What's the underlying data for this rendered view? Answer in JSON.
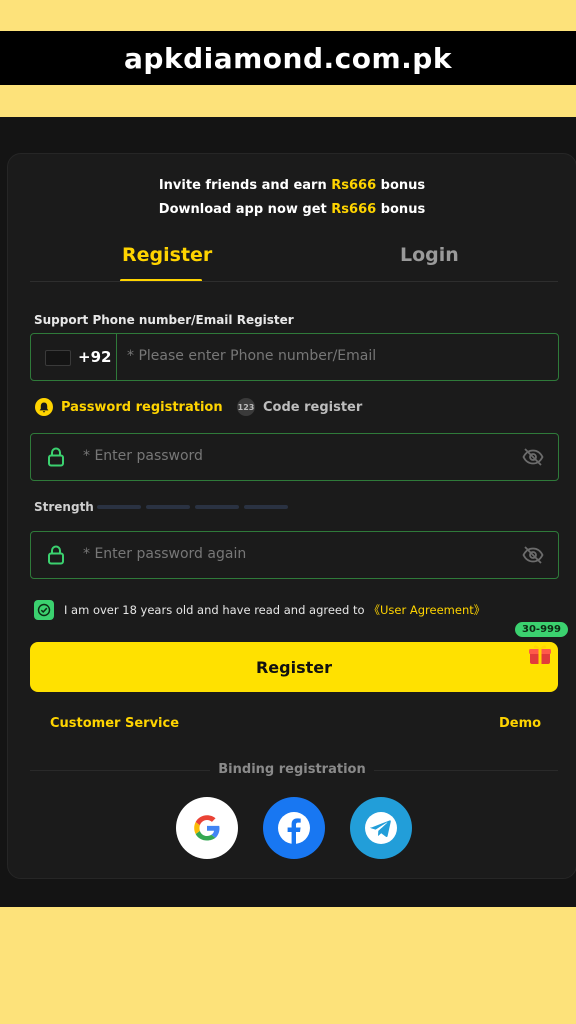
{
  "banner": {
    "site": "apkdiamond.com.pk"
  },
  "promo": {
    "line1_prefix": "Invite friends and earn ",
    "line1_amount": "Rs666",
    "line1_suffix": " bonus",
    "line2_prefix": "Download app now get ",
    "line2_amount": "Rs666",
    "line2_suffix": " bonus"
  },
  "tabs": {
    "register": "Register",
    "login": "Login"
  },
  "form": {
    "section_label": "Support Phone number/Email Register",
    "country_code": "+92",
    "phone_placeholder": "* Please enter Phone number/Email",
    "mode_password": "Password registration",
    "mode_code_icon": "123",
    "mode_code": "Code register",
    "password_placeholder": "* Enter password",
    "strength_label": "Strength",
    "password_again_placeholder": "* Enter password again",
    "agree_text": "I am over 18 years old and have read and agreed to",
    "agree_link": "《User Agreement》",
    "register_button": "Register",
    "gift_badge": "30-999"
  },
  "links": {
    "customer_service": "Customer Service",
    "demo": "Demo"
  },
  "binding": {
    "label": "Binding registration"
  },
  "colors": {
    "accent": "#ffd400",
    "success": "#3bd16f",
    "border": "#2f7a3a",
    "background": "#1b1b1b"
  },
  "icons": [
    "lock-icon",
    "eye-off-icon",
    "check-icon",
    "gift-icon",
    "google-icon",
    "facebook-icon",
    "telegram-icon"
  ]
}
